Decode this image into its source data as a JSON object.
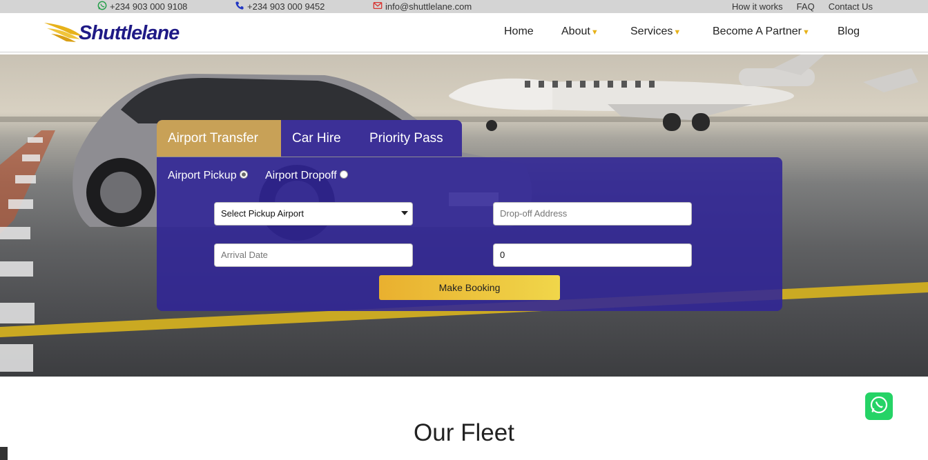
{
  "topbar": {
    "whatsapp": "+234 903 000 9108",
    "phone": "+234 903 000 9452",
    "email": "info@shuttlelane.com",
    "links": [
      "How it works",
      "FAQ",
      "Contact Us"
    ]
  },
  "brand": {
    "name": "Shuttlelane",
    "colors": {
      "primary": "#1f1a86",
      "accent": "#e7b21a"
    }
  },
  "nav": {
    "items": [
      {
        "label": "Home",
        "dropdown": false
      },
      {
        "label": "About",
        "dropdown": true
      },
      {
        "label": "Services",
        "dropdown": true
      },
      {
        "label": "Become A Partner",
        "dropdown": true
      },
      {
        "label": "Blog",
        "dropdown": false
      }
    ]
  },
  "booking": {
    "tabs": [
      "Airport Transfer",
      "Car Hire",
      "Priority Pass"
    ],
    "active_tab": "Airport Transfer",
    "options": [
      "Airport Pickup",
      "Airport Dropoff"
    ],
    "selected_option": "Airport Pickup",
    "pickup_select": "Select Pickup Airport",
    "dropoff_placeholder": "Drop-off Address",
    "date_placeholder": "Arrival Date",
    "passengers_value": "0",
    "submit": "Make Booking"
  },
  "fleet": {
    "title": "Our Fleet"
  },
  "icons": {
    "whatsapp": "whatsapp-icon",
    "phone": "phone-icon",
    "email": "envelope-icon",
    "caret": "caret-down-icon"
  }
}
